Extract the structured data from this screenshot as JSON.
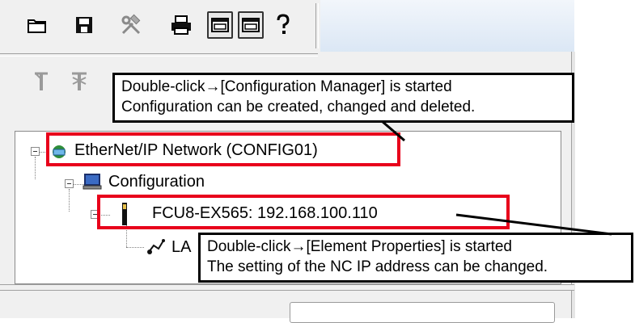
{
  "toolbar": {
    "icons": [
      "folder-open-icon",
      "save-icon",
      "tools-icon",
      "printer-icon",
      "window-icon",
      "window-alt-icon",
      "help-icon"
    ]
  },
  "pane_toolbar": {
    "icons": [
      "antenna-icon",
      "antenna-disabled-icon"
    ]
  },
  "tree": {
    "root_label": "EtherNet/IP Network (CONFIG01)",
    "configuration_label": "Configuration",
    "device_label": "FCU8-EX565: 192.168.100.110",
    "lan_label_partial": "LA"
  },
  "callouts": {
    "network": {
      "line1": "Double-click→[Configuration Manager] is started",
      "line2": "Configuration can be created, changed and deleted."
    },
    "device": {
      "line1": "Double-click→[Element Properties] is started",
      "line2": "The setting of the NC IP address can be changed."
    }
  },
  "colors": {
    "highlight": "#e8001b",
    "callout_border": "#000000",
    "toolbar_band": "#dbe7f5"
  }
}
